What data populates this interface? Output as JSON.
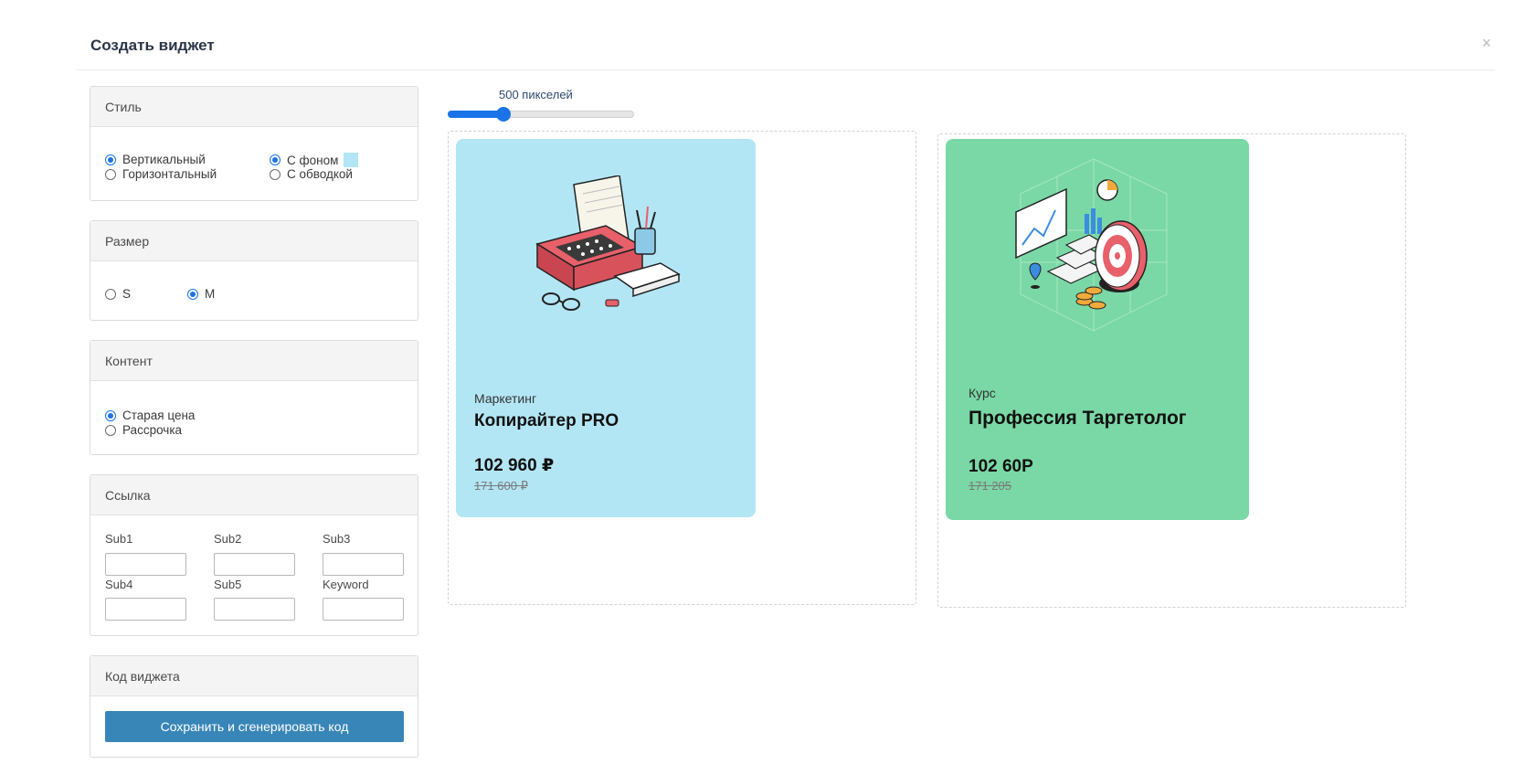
{
  "header": {
    "title": "Создать виджет",
    "close_symbol": "×"
  },
  "style_panel": {
    "title": "Стиль",
    "orientation": [
      {
        "label": "Вертикальный",
        "checked": true
      },
      {
        "label": "Горизонтальный",
        "checked": false
      }
    ],
    "fill": [
      {
        "label": "С фоном",
        "checked": true,
        "swatch_color": "#b3e6f5"
      },
      {
        "label": "С обводкой",
        "checked": false
      }
    ]
  },
  "size_panel": {
    "title": "Размер",
    "options": [
      {
        "label": "S",
        "checked": false
      },
      {
        "label": "M",
        "checked": true
      }
    ]
  },
  "content_panel": {
    "title": "Контент",
    "options": [
      {
        "label": "Старая цена",
        "checked": true
      },
      {
        "label": "Рассрочка",
        "checked": false
      }
    ]
  },
  "link_panel": {
    "title": "Ссылка",
    "fields": [
      {
        "label": "Sub1",
        "value": ""
      },
      {
        "label": "Sub2",
        "value": ""
      },
      {
        "label": "Sub3",
        "value": ""
      },
      {
        "label": "Sub4",
        "value": ""
      },
      {
        "label": "Sub5",
        "value": ""
      },
      {
        "label": "Keyword",
        "value": ""
      }
    ]
  },
  "code_panel": {
    "title": "Код виджета",
    "button_label": "Сохранить и сгенерировать код"
  },
  "slider": {
    "label": "500 пикселей",
    "value_fraction": 0.3
  },
  "cards": [
    {
      "category": "Маркетинг",
      "title": "Копирайтер PRO",
      "price": "102 960 ₽",
      "old_price": "171 600 ₽",
      "bg_color": "#b3e6f5",
      "illustration": "typewriter-illustration"
    },
    {
      "category": "Курс",
      "title": "Профессия Таргетолог",
      "price": "102 60Р",
      "old_price": "171 205",
      "bg_color": "#7ad8a6",
      "illustration": "target-illustration"
    }
  ],
  "colors": {
    "accent": "#1a73e8",
    "button": "#3886b8"
  }
}
